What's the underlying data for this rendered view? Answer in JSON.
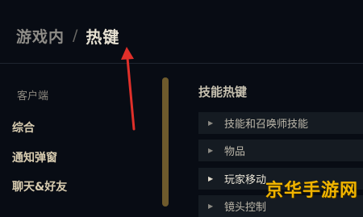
{
  "breadcrumb": {
    "parent": "游戏内",
    "separator": "/",
    "current": "热键"
  },
  "sidebar": {
    "header": "客户端",
    "items": [
      {
        "label": "综合"
      },
      {
        "label": "通知弹窗"
      },
      {
        "label": "聊天&好友"
      }
    ]
  },
  "main": {
    "section_title": "技能热键",
    "rows": [
      {
        "label": "技能和召唤师技能"
      },
      {
        "label": "物品"
      },
      {
        "label": "玩家移动"
      },
      {
        "label": "镜头控制"
      }
    ]
  },
  "watermark": "京华手游网",
  "colors": {
    "accent_gold": "#6e5a2c",
    "annotation_red": "#e0302a",
    "watermark": "#f0b400"
  }
}
